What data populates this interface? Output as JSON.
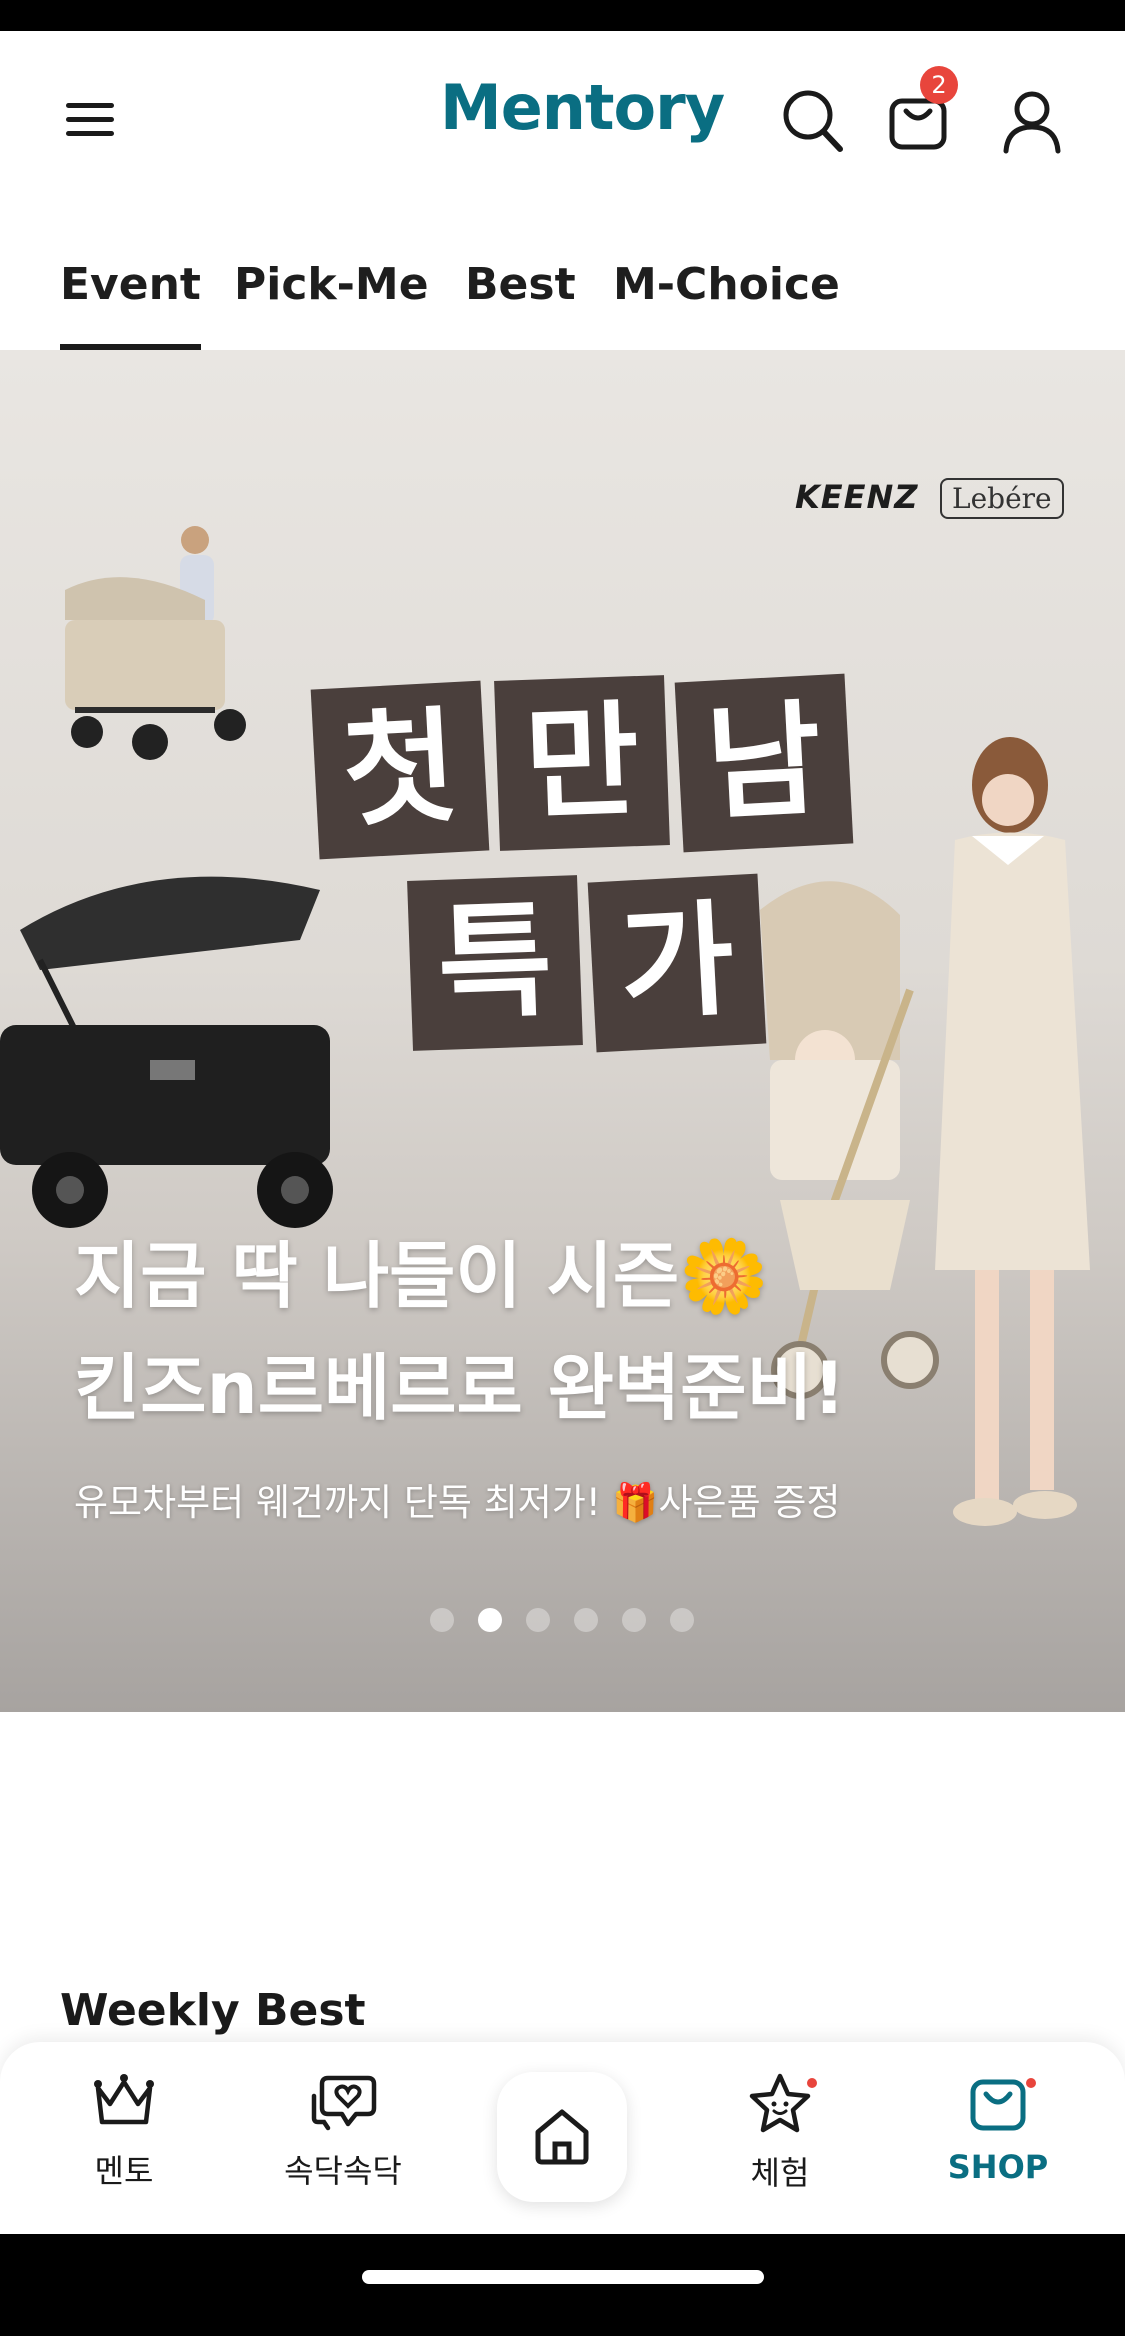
{
  "app": {
    "logo": "Mentory",
    "cart_count": "2"
  },
  "tabs": [
    {
      "label": "Event",
      "active": true
    },
    {
      "label": "Pick-Me",
      "active": false
    },
    {
      "label": "Best",
      "active": false
    },
    {
      "label": "M-Choice",
      "active": false
    }
  ],
  "banner": {
    "brand_logos": [
      "KEENZ",
      "Lebére"
    ],
    "title_chars": [
      "첫",
      "만",
      "남",
      "특",
      "가"
    ],
    "headline_line1": "지금 딱 나들이 시즌🌼",
    "headline_line2": "킨즈n르베르로 완벽준비!",
    "subtext": "유모차부터 웨건까지 단독 최저가! 🎁사은품 증정",
    "carousel": {
      "total": 6,
      "active_index": 1
    }
  },
  "section": {
    "title": "Weekly Best"
  },
  "bottom_nav": {
    "items": [
      {
        "label": "멘토",
        "icon": "crown-icon"
      },
      {
        "label": "속닥속닥",
        "icon": "chat-heart-icon"
      },
      {
        "label": "체험",
        "icon": "star-face-icon"
      },
      {
        "label": "SHOP",
        "icon": "shopping-bag-icon"
      }
    ],
    "home_icon": "home-icon"
  },
  "colors": {
    "brand": "#0a6e82",
    "badge": "#e8453c",
    "title_block": "#4a3f3c"
  }
}
